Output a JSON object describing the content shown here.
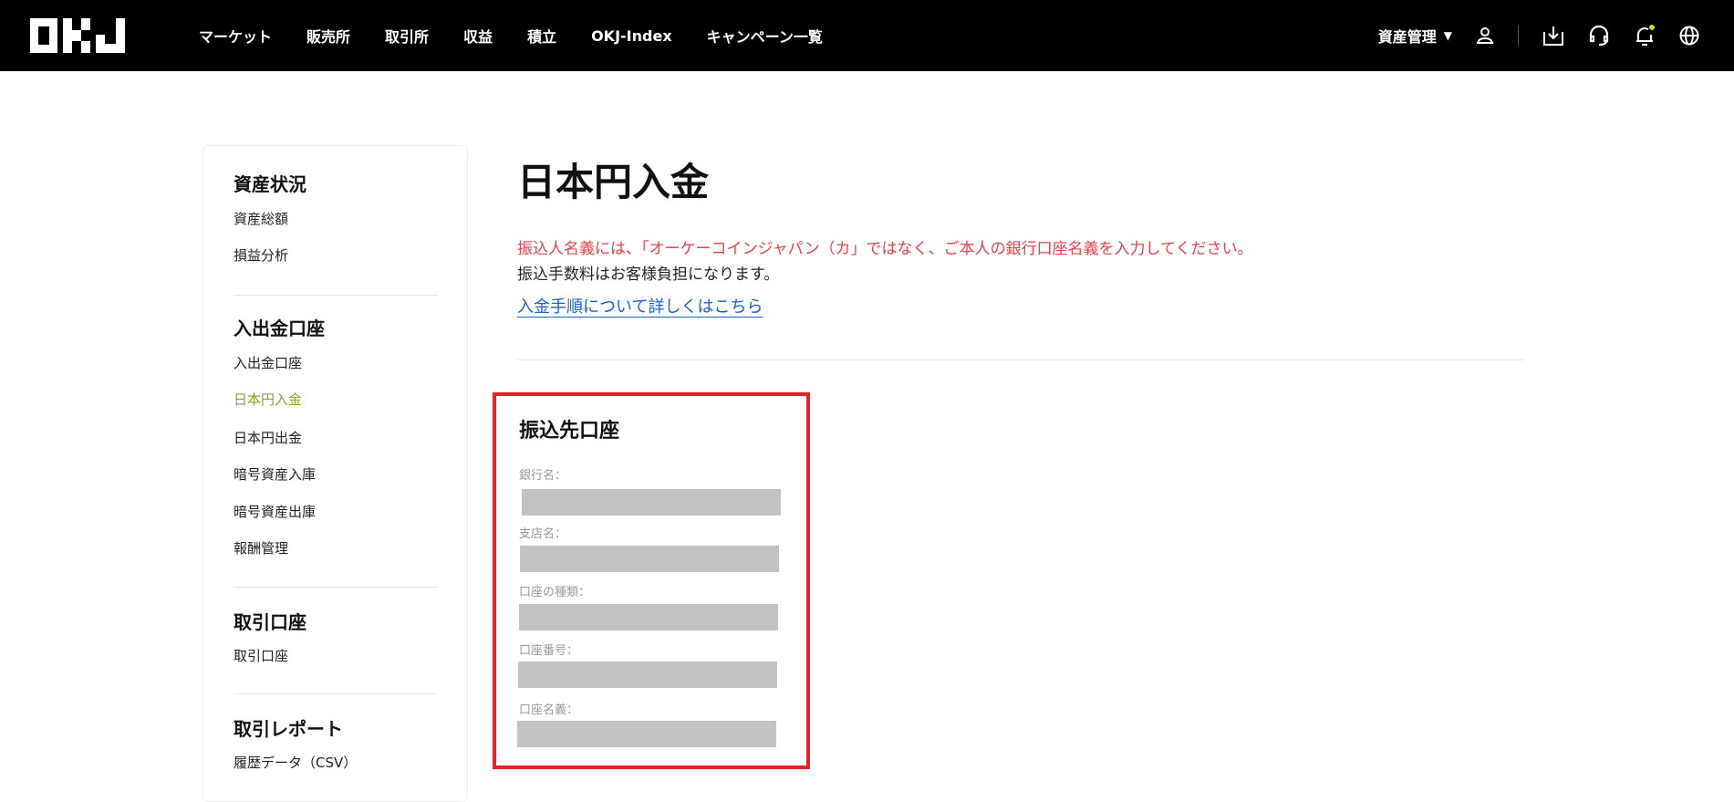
{
  "header": {
    "logo": "OKJ",
    "nav": [
      "マーケット",
      "販売所",
      "取引所",
      "収益",
      "積立",
      "OKJ-Index",
      "キャンペーン一覧"
    ],
    "asset_menu": "資産管理"
  },
  "sidebar": {
    "sections": [
      {
        "heading": "資産状況",
        "items": [
          "資産総額",
          "損益分析"
        ]
      },
      {
        "heading": "入出金口座",
        "items": [
          "入出金口座",
          "日本円入金",
          "日本円出金",
          "暗号資産入庫",
          "暗号資産出庫",
          "報酬管理"
        ]
      },
      {
        "heading": "取引口座",
        "items": [
          "取引口座"
        ]
      },
      {
        "heading": "取引レポート",
        "items": [
          "履歴データ（CSV）"
        ]
      }
    ],
    "active": "日本円入金"
  },
  "main": {
    "title": "日本円入金",
    "warning": "振込人名義には、「オーケーコインジャパン（カ」ではなく、ご本人の銀行口座名義を入力してください。",
    "note": "振込手数料はお客様負担になります。",
    "link": "入金手順について詳しくはこちら",
    "account_box": {
      "title": "振込先口座",
      "fields": [
        "銀行名：",
        "支店名：",
        "口座の種類：",
        "口座番号：",
        "口座名義："
      ]
    }
  },
  "colors": {
    "accent": "#7ca72b",
    "warning": "#e8414c",
    "link": "#1a5fd6",
    "highlight": "#e8202a"
  }
}
